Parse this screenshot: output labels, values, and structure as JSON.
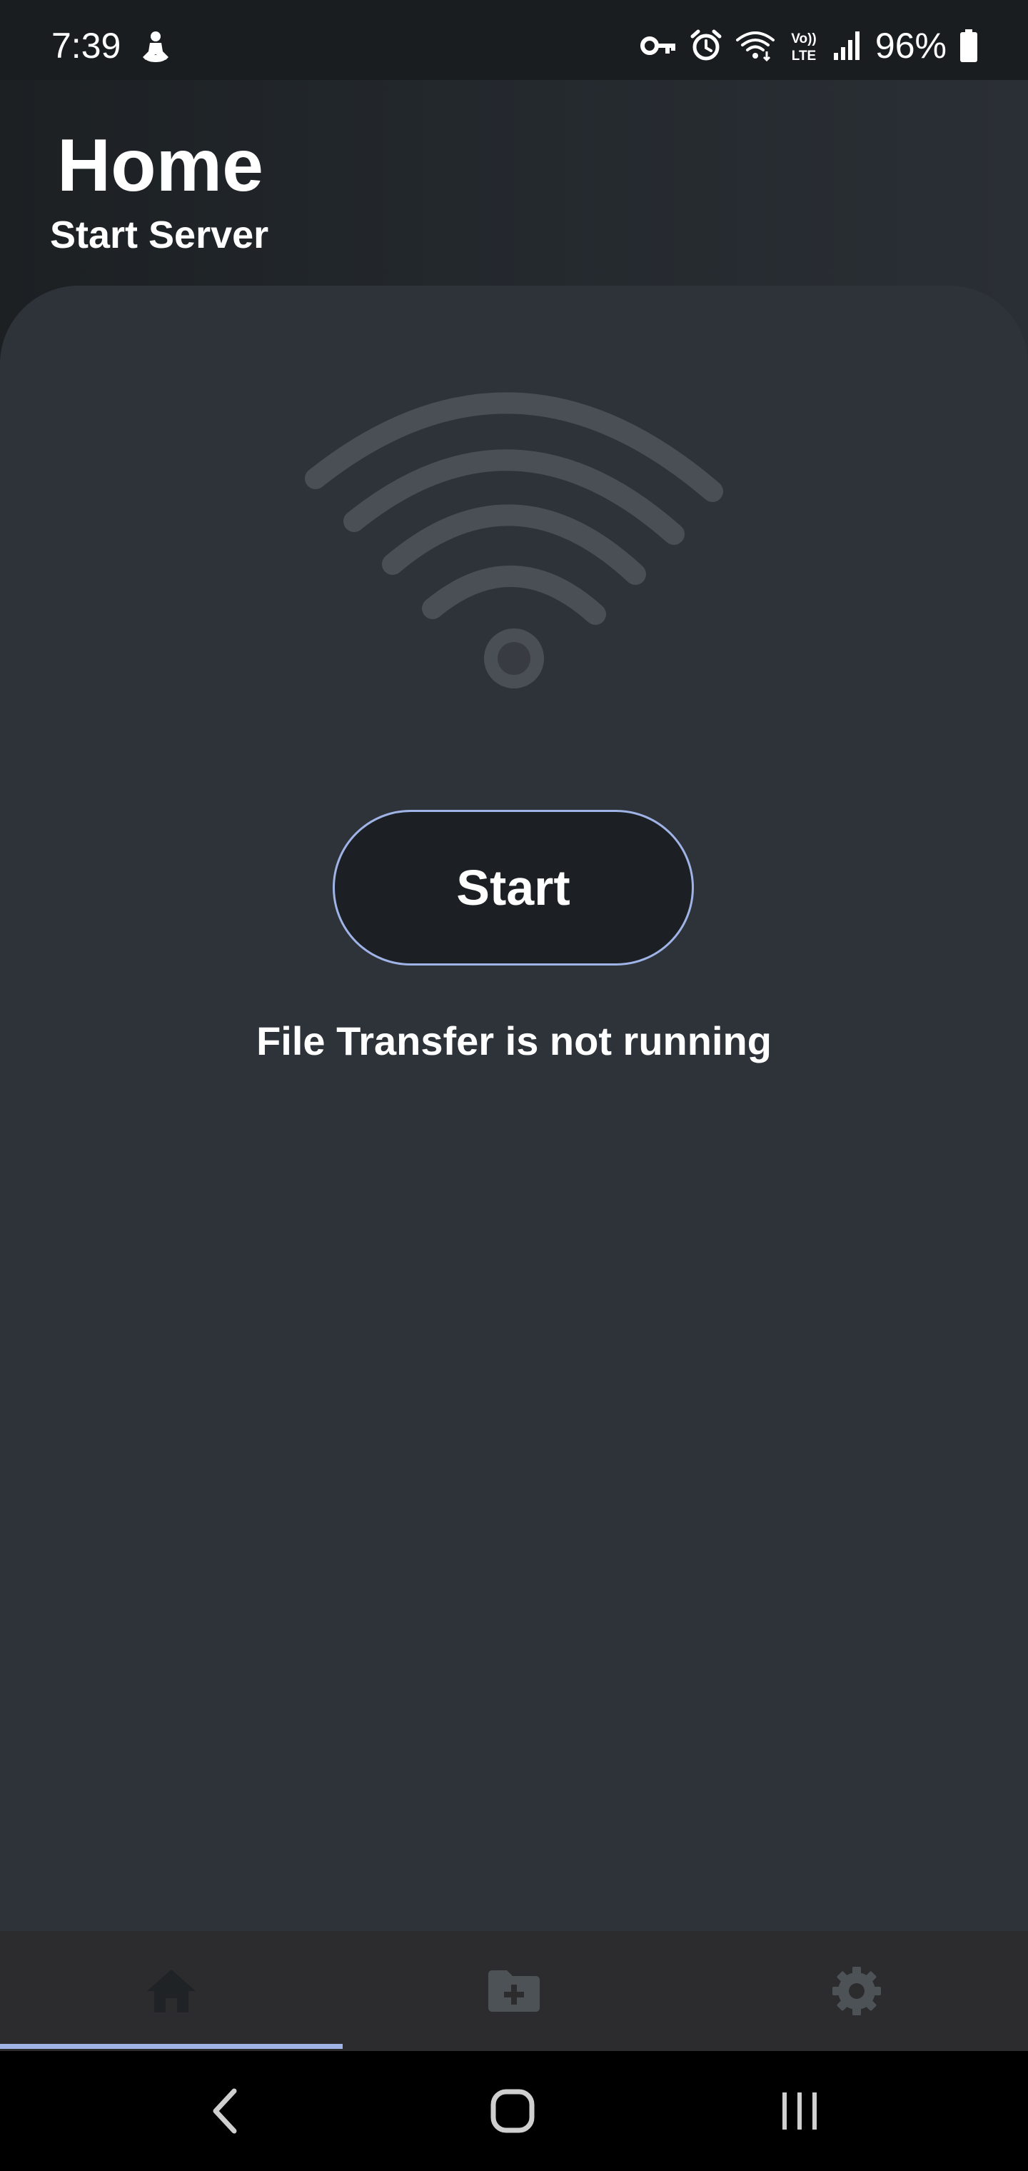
{
  "status_bar": {
    "time": "7:39",
    "battery_percent": "96%",
    "icons": [
      "person-notification-icon",
      "vpn-key-icon",
      "alarm-icon",
      "wifi-icon",
      "volte-icon",
      "cell-signal-icon",
      "battery-icon"
    ],
    "volte_label": "Vo)) LTE"
  },
  "header": {
    "title": "Home",
    "subtitle": "Start Server"
  },
  "main": {
    "illustration_icon": "wifi-icon",
    "start_button_label": "Start",
    "status_text": "File Transfer is not running"
  },
  "bottom_nav": {
    "tabs": [
      {
        "icon": "home-icon",
        "active": true
      },
      {
        "icon": "folder-add-icon",
        "active": false
      },
      {
        "icon": "gear-icon",
        "active": false
      }
    ]
  },
  "system_nav": {
    "buttons": [
      "back-icon",
      "home-button-icon",
      "recents-icon"
    ]
  },
  "colors": {
    "accent": "#9fb3e6",
    "card_background": "#2e333a",
    "header_background": "#1c2023",
    "nav_background": "#2c2c2e",
    "icon_inactive": "#4a4f55"
  }
}
